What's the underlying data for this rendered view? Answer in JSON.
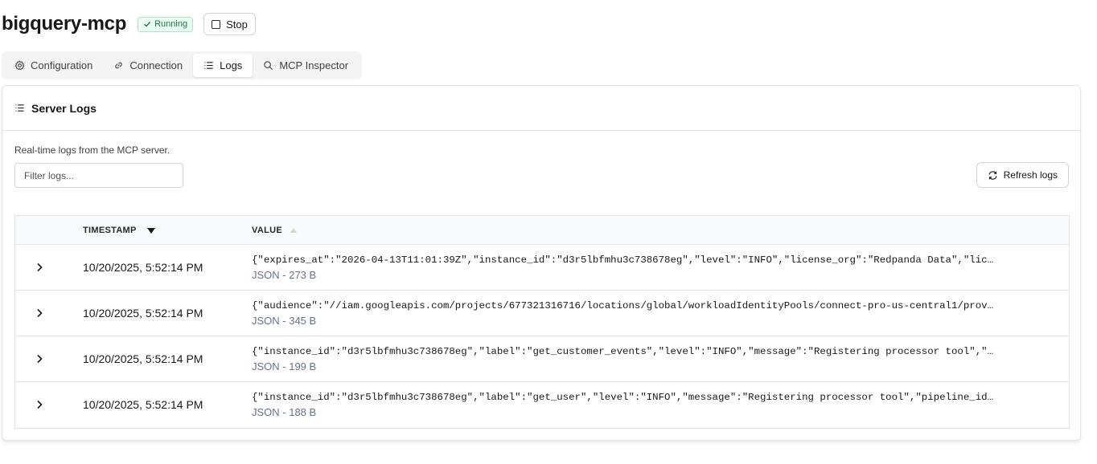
{
  "header": {
    "title": "bigquery-mcp",
    "status": "Running",
    "stop_label": "Stop"
  },
  "tabs": [
    {
      "label": "Configuration",
      "icon": "gear-icon"
    },
    {
      "label": "Connection",
      "icon": "link-icon"
    },
    {
      "label": "Logs",
      "icon": "list-icon",
      "active": true
    },
    {
      "label": "MCP Inspector",
      "icon": "search-icon"
    }
  ],
  "logs_card": {
    "title": "Server Logs",
    "description": "Real-time logs from the MCP server.",
    "filter_placeholder": "Filter logs...",
    "refresh_label": "Refresh logs",
    "columns": {
      "timestamp": "TIMESTAMP",
      "value": "VALUE"
    },
    "rows": [
      {
        "timestamp": "10/20/2025, 5:52:14 PM",
        "value": "{\"expires_at\":\"2026-04-13T11:01:39Z\",\"instance_id\":\"d3r5lbfmhu3c738678eg\",\"level\":\"INFO\",\"license_org\":\"Redpanda Data\",\"lic…",
        "meta": "JSON - 273 B"
      },
      {
        "timestamp": "10/20/2025, 5:52:14 PM",
        "value": "{\"audience\":\"//iam.googleapis.com/projects/677321316716/locations/global/workloadIdentityPools/connect-pro-us-central1/prov…",
        "meta": "JSON - 345 B"
      },
      {
        "timestamp": "10/20/2025, 5:52:14 PM",
        "value": "{\"instance_id\":\"d3r5lbfmhu3c738678eg\",\"label\":\"get_customer_events\",\"level\":\"INFO\",\"message\":\"Registering processor tool\",\"…",
        "meta": "JSON - 199 B"
      },
      {
        "timestamp": "10/20/2025, 5:52:14 PM",
        "value": "{\"instance_id\":\"d3r5lbfmhu3c738678eg\",\"label\":\"get_user\",\"level\":\"INFO\",\"message\":\"Registering processor tool\",\"pipeline_id…",
        "meta": "JSON - 188 B"
      }
    ]
  },
  "colors": {
    "accent_green": "#15803d",
    "border": "#e4e4e7",
    "muted": "#64748b"
  }
}
